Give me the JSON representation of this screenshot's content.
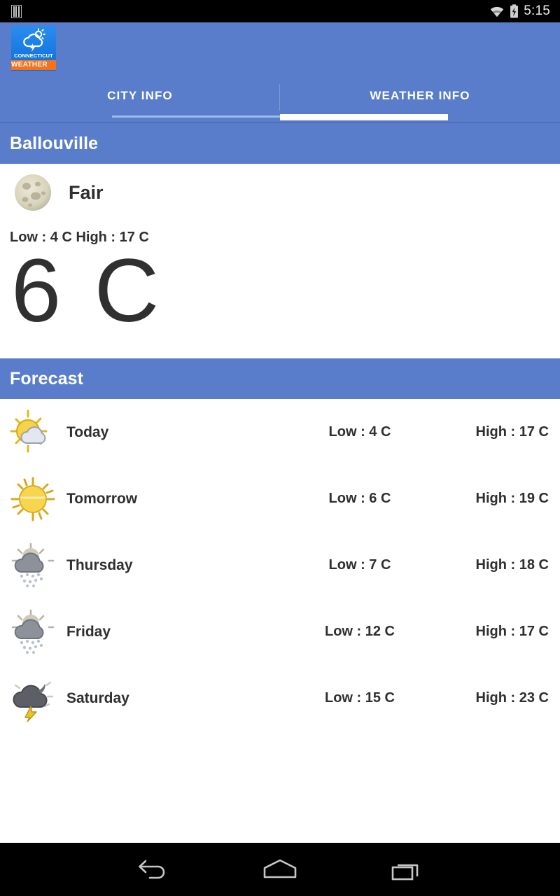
{
  "status_bar": {
    "left_icon": "sim-card-icon",
    "wifi_icon": "wifi-icon",
    "battery_icon": "battery-charging-icon",
    "time": "5:15"
  },
  "app_bar": {
    "logo": {
      "icon": "cloud-sun-lightning-icon",
      "line1": "CONNECTICUT",
      "line2": "WEATHER",
      "bg_color": "#0a6fd6",
      "accent_color": "#f4721b"
    },
    "bg_color": "#5a7dcb"
  },
  "tabs": {
    "items": [
      {
        "label": "CITY INFO",
        "active": false
      },
      {
        "label": "WEATHER INFO",
        "active": true
      }
    ]
  },
  "city_header": {
    "title": "Ballouville"
  },
  "current": {
    "condition_icon": "full-moon-icon",
    "condition": "Fair",
    "low_high": "Low : 4 C   High : 17 C",
    "temperature": "6 C"
  },
  "forecast_header": {
    "title": "Forecast"
  },
  "forecast": {
    "rows": [
      {
        "icon": "sun-behind-cloud-icon",
        "day": "Today",
        "low": "Low : 4 C",
        "high": "High : 17 C"
      },
      {
        "icon": "sun-icon",
        "day": "Tomorrow",
        "low": "Low : 6 C",
        "high": "High : 19 C"
      },
      {
        "icon": "rain-cloud-icon",
        "day": "Thursday",
        "low": "Low : 7 C",
        "high": "High : 18 C"
      },
      {
        "icon": "rain-cloud-icon",
        "day": "Friday",
        "low": "Low : 12 C",
        "high": "High : 17 C"
      },
      {
        "icon": "thunderstorm-icon",
        "day": "Saturday",
        "low": "Low : 15 C",
        "high": "High : 23 C"
      }
    ]
  },
  "nav_bar": {
    "back_icon": "back-arrow-icon",
    "home_icon": "home-icon",
    "recents_icon": "recent-apps-icon"
  }
}
